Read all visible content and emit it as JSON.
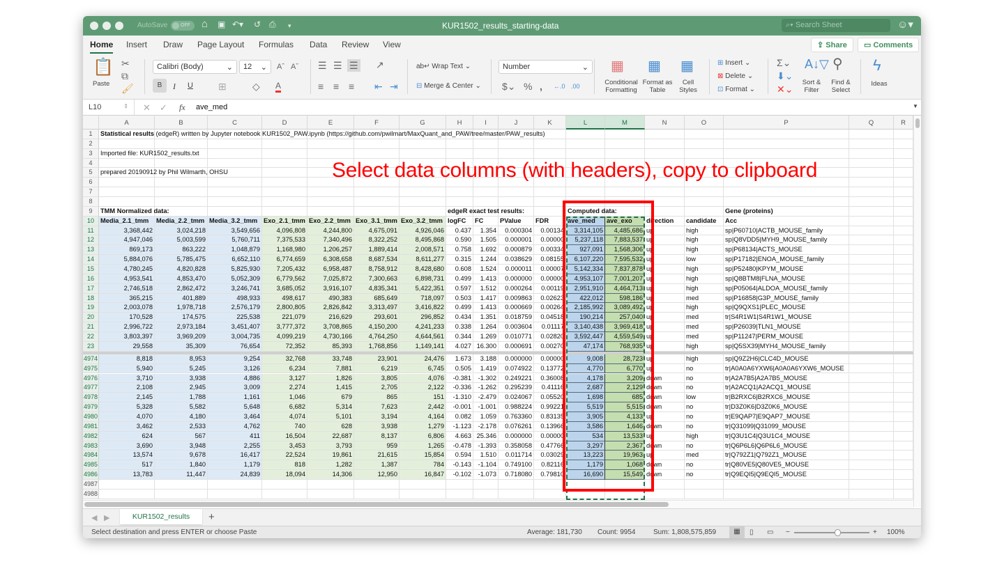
{
  "window": {
    "autosave_label": "AutoSave",
    "autosave_state": "OFF",
    "title": "KUR1502_results_starting-data",
    "search_placeholder": "Search Sheet"
  },
  "menu_tabs": [
    "Home",
    "Insert",
    "Draw",
    "Page Layout",
    "Formulas",
    "Data",
    "Review",
    "View"
  ],
  "share_label": "Share",
  "comments_label": "Comments",
  "ribbon": {
    "paste": "Paste",
    "font_name": "Calibri (Body)",
    "font_size": "12",
    "bold": "B",
    "italic": "I",
    "underline": "U",
    "wrap_text": "Wrap Text",
    "merge_center": "Merge & Center",
    "number_format": "Number",
    "conditional_formatting": "Conditional Formatting",
    "format_as_table": "Format as Table",
    "cell_styles": "Cell Styles",
    "insert": "Insert",
    "delete": "Delete",
    "format": "Format",
    "sort_filter": "Sort & Filter",
    "find_select": "Find & Select",
    "ideas": "Ideas"
  },
  "formula_bar": {
    "name_box": "L10",
    "fx": "fx",
    "value": "ave_med"
  },
  "columns": [
    "A",
    "B",
    "C",
    "D",
    "E",
    "F",
    "G",
    "H",
    "I",
    "J",
    "K",
    "L",
    "M",
    "N",
    "O",
    "P",
    "Q",
    "R"
  ],
  "selected_columns": [
    "L",
    "M"
  ],
  "rows": [
    {
      "n": "1",
      "bold": "Statistical results",
      "cells": [
        " (edgeR) written by Jupyter notebook KUR1502_PAW.ipynb (https://github.com/pwilmart/MaxQuant_and_PAW/tree/master/PAW_results)"
      ]
    },
    {
      "n": "2",
      "cells": []
    },
    {
      "n": "3",
      "cells": [
        "Imported file: KUR1502_results.txt"
      ]
    },
    {
      "n": "4",
      "cells": []
    },
    {
      "n": "5",
      "cells": [
        "prepared 20190912 by Phil Wilmarth, OHSU"
      ]
    },
    {
      "n": "6",
      "cells": []
    },
    {
      "n": "7",
      "cells": []
    },
    {
      "n": "8",
      "cells": []
    },
    {
      "n": "9",
      "cells": [
        "TMM Normalized data:",
        "",
        "",
        "",
        "",
        "",
        "",
        "edgeR exact test results:",
        "",
        "",
        "",
        "Computed data:",
        "",
        "",
        "",
        "Gene (proteins)"
      ]
    },
    {
      "n": "10",
      "cells": [
        "Media_2.1_tmm",
        "Media_2.2_tmm",
        "Media_3.2_tmm",
        "Exo_2.1_tmm",
        "Exo_2.2_tmm",
        "Exo_3.1_tmm",
        "Exo_3.2_tmm",
        "logFC",
        "FC",
        "PValue",
        "FDR",
        "ave_med",
        "ave_exo",
        "direction",
        "candidate",
        "Acc"
      ]
    },
    {
      "n": "11",
      "cells": [
        "3,368,442",
        "3,024,218",
        "3,549,656",
        "4,096,808",
        "4,244,800",
        "4,675,091",
        "4,926,046",
        "0.437",
        "1.354",
        "0.000304",
        "0.00134",
        "3,314,105",
        "4,485,686",
        "up",
        "high",
        "sp|P60710|ACTB_MOUSE_family"
      ]
    },
    {
      "n": "12",
      "cells": [
        "4,947,046",
        "5,003,599",
        "5,760,711",
        "7,375,533",
        "7,340,496",
        "8,322,252",
        "8,495,868",
        "0.590",
        "1.505",
        "0.000001",
        "0.00000",
        "5,237,118",
        "7,883,537",
        "up",
        "high",
        "sp|Q8VDD5|MYH9_MOUSE_family"
      ]
    },
    {
      "n": "13",
      "cells": [
        "869,173",
        "863,222",
        "1,048,879",
        "1,168,980",
        "1,206,257",
        "1,889,414",
        "2,008,571",
        "0.758",
        "1.692",
        "0.000879",
        "0.00334",
        "927,091",
        "1,568,306",
        "up",
        "high",
        "sp|P68134|ACTS_MOUSE"
      ]
    },
    {
      "n": "14",
      "cells": [
        "5,884,076",
        "5,785,475",
        "6,652,110",
        "6,774,659",
        "6,308,658",
        "8,687,534",
        "8,611,277",
        "0.315",
        "1.244",
        "0.038629",
        "0.08155",
        "6,107,220",
        "7,595,532",
        "up",
        "low",
        "sp|P17182|ENOA_MOUSE_family"
      ]
    },
    {
      "n": "15",
      "cells": [
        "4,780,245",
        "4,820,828",
        "5,825,930",
        "7,205,432",
        "6,958,487",
        "8,758,912",
        "8,428,680",
        "0.608",
        "1.524",
        "0.000011",
        "0.00007",
        "5,142,334",
        "7,837,878",
        "up",
        "high",
        "sp|P52480|KPYM_MOUSE"
      ]
    },
    {
      "n": "16",
      "cells": [
        "4,953,541",
        "4,853,470",
        "5,052,309",
        "6,779,562",
        "7,025,872",
        "7,300,663",
        "6,898,731",
        "0.499",
        "1.413",
        "0.000000",
        "0.00000",
        "4,953,107",
        "7,001,207",
        "up",
        "high",
        "sp|Q8BTM8|FLNA_MOUSE"
      ]
    },
    {
      "n": "17",
      "cells": [
        "2,746,518",
        "2,862,472",
        "3,246,741",
        "3,685,052",
        "3,916,107",
        "4,835,341",
        "5,422,351",
        "0.597",
        "1.512",
        "0.000264",
        "0.00119",
        "2,951,910",
        "4,464,713",
        "up",
        "high",
        "sp|P05064|ALDOA_MOUSE_family"
      ]
    },
    {
      "n": "18",
      "cells": [
        "365,215",
        "401,889",
        "498,933",
        "498,617",
        "490,383",
        "685,649",
        "718,097",
        "0.503",
        "1.417",
        "0.009863",
        "0.02623",
        "422,012",
        "598,186",
        "up",
        "med",
        "sp|P16858|G3P_MOUSE_family"
      ]
    },
    {
      "n": "19",
      "cells": [
        "2,003,078",
        "1,978,718",
        "2,576,179",
        "2,800,805",
        "2,826,842",
        "3,313,497",
        "3,416,822",
        "0.499",
        "1.413",
        "0.000669",
        "0.00264",
        "2,185,992",
        "3,089,492",
        "up",
        "high",
        "sp|Q9QXS1|PLEC_MOUSE"
      ]
    },
    {
      "n": "20",
      "cells": [
        "170,528",
        "174,575",
        "225,538",
        "221,079",
        "216,629",
        "293,601",
        "296,852",
        "0.434",
        "1.351",
        "0.018759",
        "0.04518",
        "190,214",
        "257,040",
        "up",
        "med",
        "tr|S4R1W1|S4R1W1_MOUSE"
      ]
    },
    {
      "n": "21",
      "cells": [
        "2,996,722",
        "2,973,184",
        "3,451,407",
        "3,777,372",
        "3,708,865",
        "4,150,200",
        "4,241,233",
        "0.338",
        "1.264",
        "0.003604",
        "0.01117",
        "3,140,438",
        "3,969,418",
        "up",
        "med",
        "sp|P26039|TLN1_MOUSE"
      ]
    },
    {
      "n": "22",
      "cells": [
        "3,803,397",
        "3,969,209",
        "3,004,735",
        "4,099,219",
        "4,730,166",
        "4,764,250",
        "4,644,561",
        "0.344",
        "1.269",
        "0.010771",
        "0.02820",
        "3,592,447",
        "4,559,549",
        "up",
        "med",
        "sp|P11247|PERM_MOUSE"
      ]
    },
    {
      "n": "23",
      "cells": [
        "29,558",
        "35,309",
        "76,654",
        "72,352",
        "85,393",
        "1,768,856",
        "1,149,141",
        "4.027",
        "16.300",
        "0.000691",
        "0.00270",
        "47,174",
        "768,935",
        "up",
        "high",
        "sp|Q5SX39|MYH4_MOUSE_family"
      ]
    },
    {
      "n": "4974",
      "cells": [
        "8,818",
        "8,953",
        "9,254",
        "32,768",
        "33,748",
        "23,901",
        "24,476",
        "1.673",
        "3.188",
        "0.000000",
        "0.00000",
        "9,008",
        "28,723",
        "up",
        "high",
        "sp|Q9Z2H6|CLC4D_MOUSE"
      ]
    },
    {
      "n": "4975",
      "cells": [
        "5,940",
        "5,245",
        "3,126",
        "6,234",
        "7,881",
        "6,219",
        "6,745",
        "0.505",
        "1.419",
        "0.074922",
        "0.13772",
        "4,770",
        "6,770",
        "up",
        "no",
        "tr|A0A0A6YXW6|A0A0A6YXW6_MOUSE"
      ]
    },
    {
      "n": "4976",
      "cells": [
        "3,710",
        "3,938",
        "4,886",
        "3,127",
        "1,826",
        "3,805",
        "4,076",
        "-0.381",
        "-1.302",
        "0.249221",
        "0.36008",
        "4,178",
        "3,209",
        "down",
        "no",
        "tr|A2A7B5|A2A7B5_MOUSE"
      ]
    },
    {
      "n": "4977",
      "cells": [
        "2,108",
        "2,945",
        "3,009",
        "2,274",
        "1,415",
        "2,705",
        "2,122",
        "-0.336",
        "-1.262",
        "0.295239",
        "0.41116",
        "2,687",
        "2,129",
        "down",
        "no",
        "tr|A2ACQ1|A2ACQ1_MOUSE"
      ]
    },
    {
      "n": "4978",
      "cells": [
        "2,145",
        "1,788",
        "1,161",
        "1,046",
        "679",
        "865",
        "151",
        "-1.310",
        "-2.479",
        "0.024067",
        "0.05520",
        "1,698",
        "685",
        "down",
        "low",
        "tr|B2RXC6|B2RXC6_MOUSE"
      ]
    },
    {
      "n": "4979",
      "cells": [
        "5,328",
        "5,582",
        "5,648",
        "6,682",
        "5,314",
        "7,623",
        "2,442",
        "-0.001",
        "-1.001",
        "0.988224",
        "0.99221",
        "5,519",
        "5,515",
        "down",
        "no",
        "tr|D3Z0K6|D3Z0K6_MOUSE"
      ]
    },
    {
      "n": "4980",
      "cells": [
        "4,070",
        "4,180",
        "3,464",
        "4,074",
        "5,101",
        "3,194",
        "4,164",
        "0.082",
        "1.059",
        "0.763360",
        "0.83135",
        "3,905",
        "4,133",
        "up",
        "no",
        "tr|E9QAP7|E9QAP7_MOUSE"
      ]
    },
    {
      "n": "4981",
      "cells": [
        "3,462",
        "2,533",
        "4,762",
        "740",
        "628",
        "3,938",
        "1,279",
        "-1.123",
        "-2.178",
        "0.076261",
        "0.13966",
        "3,586",
        "1,646",
        "down",
        "no",
        "tr|Q31099|Q31099_MOUSE"
      ]
    },
    {
      "n": "4982",
      "cells": [
        "624",
        "567",
        "411",
        "16,504",
        "22,687",
        "8,137",
        "6,806",
        "4.663",
        "25.346",
        "0.000000",
        "0.00000",
        "534",
        "13,533",
        "up",
        "high",
        "tr|Q3U1C4|Q3U1C4_MOUSE"
      ]
    },
    {
      "n": "4983",
      "cells": [
        "3,690",
        "3,948",
        "2,255",
        "3,453",
        "3,793",
        "959",
        "1,265",
        "-0.478",
        "-1.393",
        "0.358058",
        "0.47766",
        "3,297",
        "2,367",
        "down",
        "no",
        "tr|Q6P6L6|Q6P6L6_MOUSE"
      ]
    },
    {
      "n": "4984",
      "cells": [
        "13,574",
        "9,678",
        "16,417",
        "22,524",
        "19,861",
        "21,615",
        "15,854",
        "0.594",
        "1.510",
        "0.011714",
        "0.03029",
        "13,223",
        "19,963",
        "up",
        "med",
        "tr|Q792Z1|Q792Z1_MOUSE"
      ]
    },
    {
      "n": "4985",
      "cells": [
        "517",
        "1,840",
        "1,179",
        "818",
        "1,282",
        "1,387",
        "784",
        "-0.143",
        "-1.104",
        "0.749100",
        "0.82116",
        "1,179",
        "1,068",
        "down",
        "no",
        "tr|Q80VE5|Q80VE5_MOUSE"
      ]
    },
    {
      "n": "4986",
      "cells": [
        "13,783",
        "11,447",
        "24,839",
        "18,094",
        "14,306",
        "12,950",
        "16,847",
        "-0.102",
        "-1.073",
        "0.718080",
        "0.79810",
        "16,690",
        "15,549",
        "down",
        "no",
        "tr|Q9EQI5|Q9EQI5_MOUSE"
      ]
    },
    {
      "n": "4987",
      "cells": []
    },
    {
      "n": "4988",
      "cells": []
    }
  ],
  "annotation": "Select data columns (with headers), copy to clipboard",
  "sheet_tab": "KUR1502_results",
  "status": {
    "message": "Select destination and press ENTER or choose Paste",
    "average": "Average: 181,730",
    "count": "Count: 9954",
    "sum": "Sum: 1,808,575,859",
    "zoom": "100%"
  },
  "colors": {
    "accent": "#217346",
    "titlebar": "#5e9b74",
    "annotation": "#ff0000"
  }
}
